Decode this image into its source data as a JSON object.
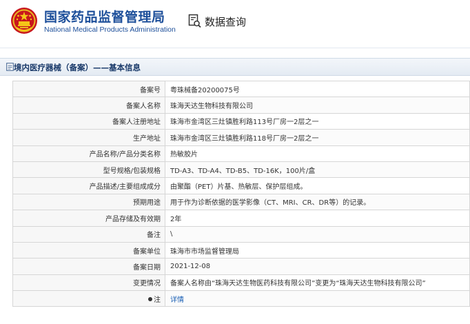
{
  "header": {
    "agency_cn": "国家药品监督管理局",
    "agency_en": "National Medical Products Administration",
    "query_label": "数据查询",
    "emblem_icon": "national-emblem-icon",
    "query_icon": "data-query-icon",
    "brand_color": "#1d4f9a"
  },
  "section": {
    "title": "境内医疗器械（备案）——基本信息",
    "icon": "document-icon"
  },
  "rows": [
    {
      "label": "备案号",
      "value": "粤珠械备20200075号"
    },
    {
      "label": "备案人名称",
      "value": "珠海天达生物科技有限公司"
    },
    {
      "label": "备案人注册地址",
      "value": "珠海市金湾区三灶镇胜利路113号厂房一2层之一"
    },
    {
      "label": "生产地址",
      "value": "珠海市金湾区三灶镇胜利路118号厂房一2层之一"
    },
    {
      "label": "产品名称/产品分类名称",
      "value": "热敏胶片"
    },
    {
      "label": "型号规格/包装规格",
      "value": "TD-A3、TD-A4、TD-B5、TD-16K，100片/盒"
    },
    {
      "label": "产品描述/主要组成成分",
      "value": "由聚酯（PET）片基、热敏层、保护层组成。"
    },
    {
      "label": "预期用途",
      "value": "用于作为诊断依据的医学影像（CT、MRI、CR、DR等）的记录。"
    },
    {
      "label": "产品存储及有效期",
      "value": "2年"
    },
    {
      "label": "备注",
      "value": "\\"
    },
    {
      "label": "备案单位",
      "value": "珠海市市场监督管理局"
    },
    {
      "label": "备案日期",
      "value": "2021-12-08"
    },
    {
      "label": "变更情况",
      "value": "备案人名称由“珠海天达生物医药科技有限公司”变更为“珠海天达生物科技有限公司”"
    },
    {
      "label": "注",
      "value": "详情",
      "link": true,
      "icon": "bullet-icon",
      "link_color": "#1a5fb4"
    }
  ]
}
